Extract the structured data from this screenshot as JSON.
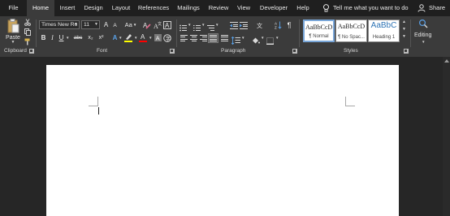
{
  "tabs": [
    "File",
    "Home",
    "Insert",
    "Design",
    "Layout",
    "References",
    "Mailings",
    "Review",
    "View",
    "Developer",
    "Help"
  ],
  "active_tab": "Home",
  "tell_me": "Tell me what you want to do",
  "share": "Share",
  "clipboard": {
    "paste_label": "Paste",
    "group_label": "Clipboard"
  },
  "font": {
    "name": "Times New Ro",
    "size": "11",
    "grow": "A",
    "shrink": "A",
    "case": "Aa",
    "bold": "B",
    "italic": "I",
    "underline": "U",
    "strike": "abc",
    "subscript": "x₂",
    "superscript": "x²",
    "text_effects": "A",
    "font_color": "A",
    "highlight_color": "#ffff00",
    "font_color_value": "#ff0000",
    "group_label": "Font"
  },
  "paragraph": {
    "group_label": "Paragraph",
    "pilcrow": "¶"
  },
  "styles": {
    "group_label": "Styles",
    "items": [
      {
        "sample": "AaBbCcD",
        "name": "¶ Normal"
      },
      {
        "sample": "AaBbCcD",
        "name": "¶ No Spac..."
      },
      {
        "sample": "AaBbC",
        "name": "Heading 1"
      }
    ]
  },
  "editing": {
    "label": "Editing"
  }
}
